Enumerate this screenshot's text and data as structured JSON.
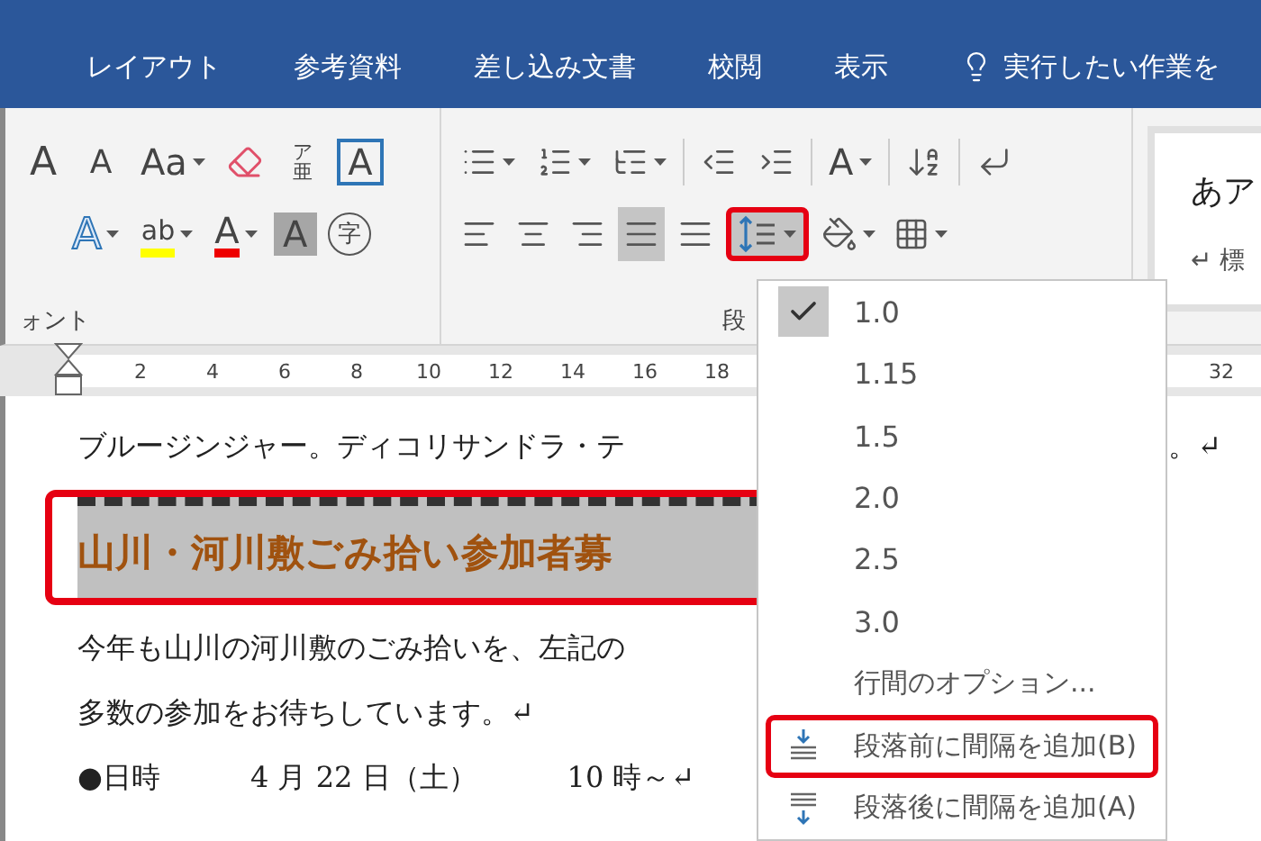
{
  "tabs": [
    {
      "label": "レイアウト"
    },
    {
      "label": "参考資料"
    },
    {
      "label": "差し込み文書"
    },
    {
      "label": "校閲"
    },
    {
      "label": "表示"
    }
  ],
  "tell_me": {
    "placeholder": "実行したい作業を"
  },
  "font_group": {
    "label": "ォント",
    "row_1": [
      {
        "kind": "grow",
        "text": "A"
      },
      {
        "kind": "shrink",
        "text": "A"
      },
      {
        "kind": "case",
        "text": "Aa"
      },
      {
        "kind": "eraser"
      },
      {
        "kind": "ruby",
        "text": "ア亜"
      },
      {
        "kind": "boxed",
        "text": "A"
      }
    ],
    "row_2": [
      {
        "kind": "effect",
        "text": "A"
      },
      {
        "kind": "highlighter",
        "text": "ab",
        "color": "#ffff00"
      },
      {
        "kind": "fontcolor",
        "text": "A",
        "color": "#ee0000"
      },
      {
        "kind": "shaded",
        "text": "A"
      },
      {
        "kind": "circled",
        "text": "字"
      }
    ]
  },
  "paragraph_group": {
    "label": "段",
    "row_1": [
      {
        "kind": "bullets"
      },
      {
        "kind": "numbering"
      },
      {
        "kind": "multilevel"
      },
      {
        "kind": "sep"
      },
      {
        "kind": "outdent"
      },
      {
        "kind": "indent"
      },
      {
        "kind": "sep"
      },
      {
        "kind": "asian",
        "text": "A"
      },
      {
        "kind": "sep"
      },
      {
        "kind": "sort"
      },
      {
        "kind": "sep"
      },
      {
        "kind": "marks"
      }
    ],
    "row_2": [
      {
        "kind": "left",
        "selected": false
      },
      {
        "kind": "center",
        "selected": false
      },
      {
        "kind": "right",
        "selected": false
      },
      {
        "kind": "justify",
        "selected": true
      },
      {
        "kind": "distributed",
        "selected": false
      },
      {
        "kind": "spacing",
        "highlight": true
      },
      {
        "kind": "shading",
        "selected": false
      },
      {
        "kind": "borders",
        "selected": false
      }
    ]
  },
  "styles": {
    "sample": "あア",
    "name": "↵ 標"
  },
  "ruler": {
    "numbers": [
      "2",
      "4",
      "6",
      "8",
      "10",
      "12",
      "14",
      "16",
      "18"
    ],
    "right_number": "32"
  },
  "document": {
    "lines": [
      {
        "kind": "text",
        "parts": [
          "ブルージンジャー。ディコリサンドラ・テ"
        ],
        "tail": "。↵"
      },
      {
        "kind": "heading",
        "parts": [
          "山川・河川敷ごみ拾い参加者募"
        ],
        "highlight": true
      },
      {
        "kind": "text",
        "parts": [
          "今年も山川の河川敷のごみ拾いを、左記の"
        ]
      },
      {
        "kind": "text",
        "parts": [
          "多数の参加をお待ちしています。↵"
        ]
      },
      {
        "kind": "text",
        "parts": [
          "●日時",
          "4 月 22 日（土）",
          "10 時～↵"
        ]
      }
    ]
  },
  "menu": {
    "items": [
      {
        "kind": "value",
        "label": "1.0",
        "checked": true,
        "highlight": false
      },
      {
        "kind": "value",
        "label": "1.15",
        "checked": false,
        "highlight": false
      },
      {
        "kind": "value",
        "label": "1.5",
        "checked": false,
        "highlight": false
      },
      {
        "kind": "value",
        "label": "2.0",
        "checked": false,
        "highlight": false
      },
      {
        "kind": "value",
        "label": "2.5",
        "checked": false,
        "highlight": false
      },
      {
        "kind": "value",
        "label": "3.0",
        "checked": false,
        "highlight": false
      },
      {
        "kind": "options",
        "label": "行間のオプション...",
        "checked": false,
        "highlight": false
      },
      {
        "kind": "before",
        "label": "段落前に間隔を追加(B)",
        "checked": false,
        "highlight": true
      },
      {
        "kind": "after",
        "label": "段落後に間隔を追加(A)",
        "checked": false,
        "highlight": false
      }
    ]
  }
}
